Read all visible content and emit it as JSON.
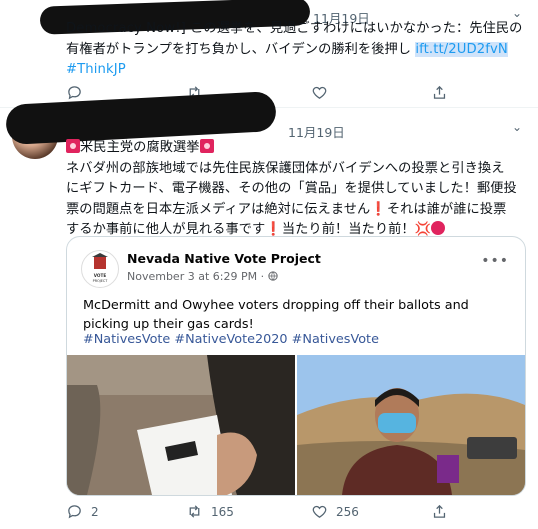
{
  "tweet1": {
    "date": "11月19日",
    "line1": "Democracy Now!] この選挙を、見過ごすわけにはいかなかった：先住民の",
    "line2": "有権者がトランプを打ち負かし、バイデンの勝利を後押し",
    "link": "ift.tt/2UD2fvN",
    "hashtag": "#ThinkJP"
  },
  "tweet2": {
    "date": "11月19日",
    "line1": "米民主党の腐敗選挙",
    "line2": "ネバダ州の部族地域では先住民族保護団体がバイデンへの投票と引き換え",
    "line3": "にギフトカード、電子機器、その他の「賞品」を提供していました！郵便投",
    "line4": "票の問題点を日本左派メディアは絶対に伝えません",
    "line4b": "それは誰が誰に投票",
    "line5": "するか事前に他人が見れる事です",
    "line5b": "当たり前！当たり前！",
    "card": {
      "page_name": "Nevada Native Vote Project",
      "post_date": "November 3 at 6:29 PM · ",
      "logo_text": "Nevada Native Vote Project",
      "text": "McDermitt and Owyhee voters dropping off their ballots and picking up their gas cards!",
      "hashtags": "#NativesVote #NativeVote2020 #NativesVote"
    },
    "replies": "2",
    "retweets": "165",
    "likes": "256"
  },
  "colors": {
    "accent": "#1d9bf0",
    "secondary": "#536471",
    "red": "#e0245e"
  }
}
